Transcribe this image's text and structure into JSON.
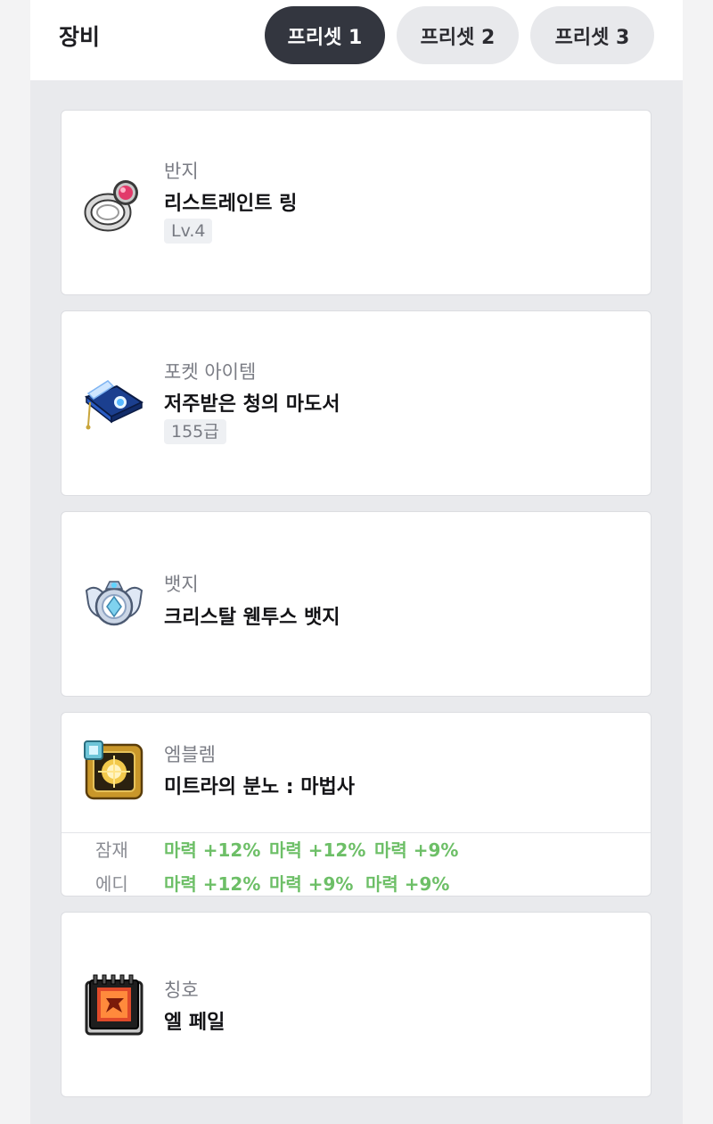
{
  "header": {
    "title": "장비",
    "presets": [
      {
        "label": "프리셋 1",
        "active": true
      },
      {
        "label": "프리셋 2",
        "active": false
      },
      {
        "label": "프리셋 3",
        "active": false
      }
    ]
  },
  "items": [
    {
      "category": "반지",
      "name": "리스트레인트 링",
      "tag": "Lv.4",
      "icon": "ring-icon"
    },
    {
      "category": "포켓 아이템",
      "name": "저주받은 청의 마도서",
      "tag": "155급",
      "icon": "spellbook-icon"
    },
    {
      "category": "뱃지",
      "name": "크리스탈 웬투스 뱃지",
      "icon": "badge-icon"
    },
    {
      "category": "엠블렘",
      "name": "미트라의 분노 : 마법사",
      "icon": "emblem-icon",
      "potential": {
        "label": "잠재",
        "stats": [
          "마력 +12%",
          "마력 +12%",
          "마력 +9%"
        ]
      },
      "additional": {
        "label": "에디",
        "stats": [
          "마력 +12%",
          "마력 +9%",
          "마력 +9%"
        ]
      }
    },
    {
      "category": "칭호",
      "name": "엘 페일",
      "icon": "title-book-icon"
    }
  ],
  "colors": {
    "accent_green": "#6dbf67",
    "active_tab": "#33363f"
  }
}
